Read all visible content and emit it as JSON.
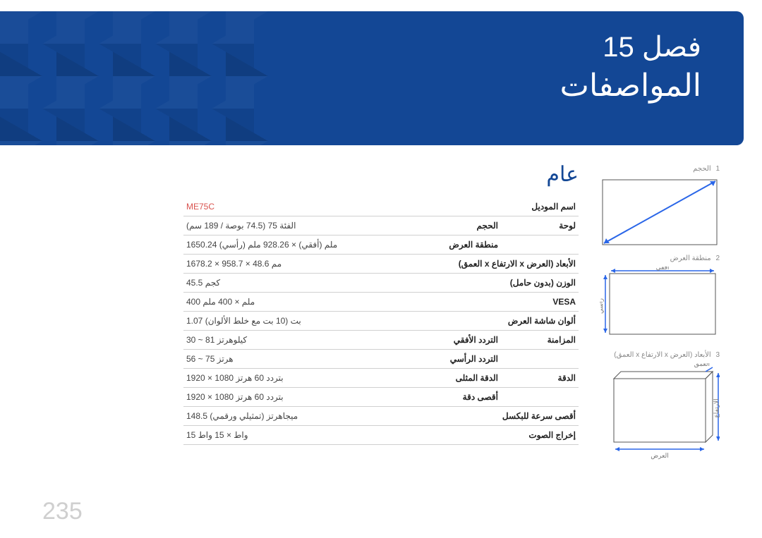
{
  "chapter": {
    "prefix": "فصل",
    "number": "15",
    "title": "المواصفات"
  },
  "section": {
    "title": "عام"
  },
  "diagram_captions": {
    "d1": {
      "num": "1",
      "text": "الحجم"
    },
    "d2": {
      "num": "2",
      "text": "منطقة العرض"
    },
    "d3": {
      "num": "3",
      "text": "الأبعاد (العرض x الارتفاع x العمق)"
    }
  },
  "diagram_axis": {
    "h": "أفقي",
    "v": "رأسي",
    "width": "العرض",
    "height": "الارتفاع",
    "depth": "العمق"
  },
  "spec": {
    "model_name_label": "اسم الموديل",
    "model_name": "ME75C",
    "rows": [
      {
        "label": "لوحة",
        "sub": "الحجم",
        "val": "الفئة 75 (74.5 بوصة / 189 سم)"
      },
      {
        "label": "",
        "sub": "منطقة العرض",
        "val": "1650.24 ملم (أفقي) × 928.26 ملم (رأسي)"
      },
      {
        "label": "الأبعاد (العرض x الارتفاع x العمق)",
        "sub": "",
        "val": "1678.2 × 958.7 × 48.6 مم"
      },
      {
        "label": "الوزن (بدون حامل)",
        "sub": "",
        "val": "45.5 كجم"
      },
      {
        "label": "VESA",
        "sub": "",
        "val": "400 ملم × 400 ملم"
      },
      {
        "label": "ألوان شاشة العرض",
        "sub": "",
        "val": "1.07 بت (10 بت مع خلط الألوان)"
      },
      {
        "label": "المزامنة",
        "sub": "التردد الأفقي",
        "val": "30 ~ 81 كيلوهرتز"
      },
      {
        "label": "",
        "sub": "التردد الرأسي",
        "val": "56 ~ 75 هرتز"
      },
      {
        "label": "الدقة",
        "sub": "الدقة المثلى",
        "val": "1920 × 1080 بتردد 60 هرتز"
      },
      {
        "label": "",
        "sub": "أقصى دقة",
        "val": "1920 × 1080 بتردد 60 هرتز"
      },
      {
        "label": "أقصى سرعة للبكسل",
        "sub": "",
        "val": "148.5 ميجاهرتز (تمثيلي ورقمي)"
      },
      {
        "label": "إخراج الصوت",
        "sub": "",
        "val": "15 واط × 15 واط"
      }
    ]
  },
  "page_number": "235"
}
